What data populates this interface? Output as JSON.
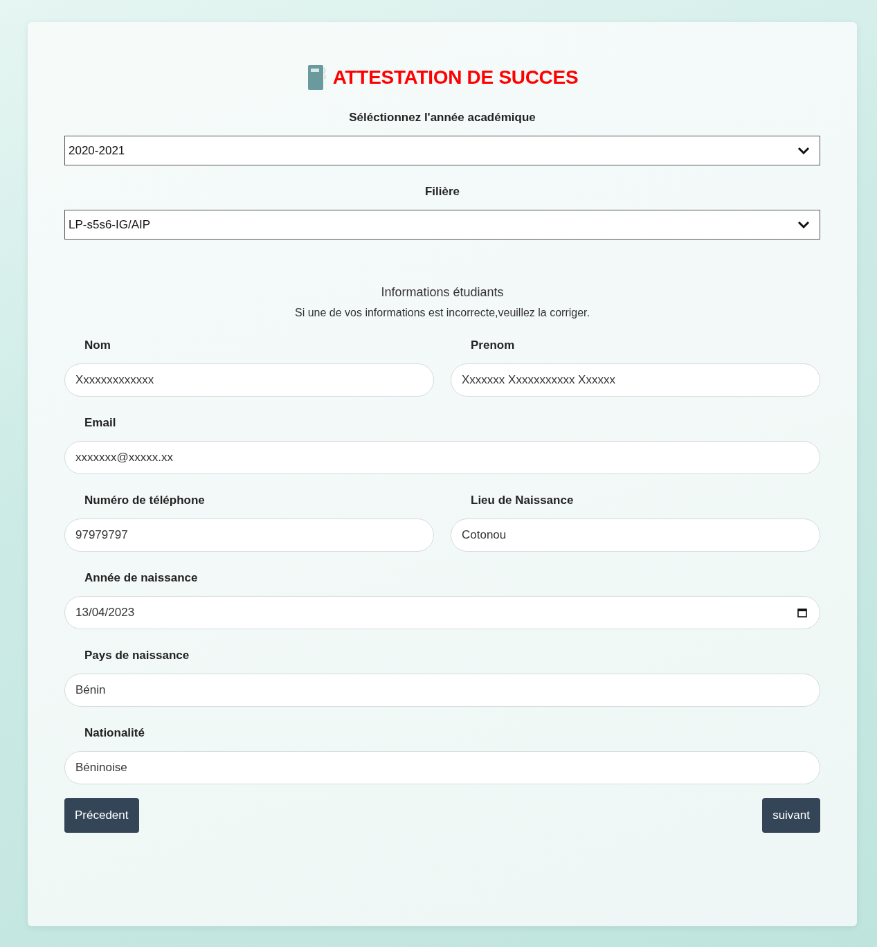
{
  "title": "ATTESTATION DE SUCCES",
  "selects": [
    {
      "label": "Séléctionnez l'année académique",
      "value": "2020-2021"
    },
    {
      "label": "Filière",
      "value": "LP-s5s6-IG/AIP"
    }
  ],
  "info": {
    "heading": "Informations étudiants",
    "note": "Si une de vos informations est incorrecte,veuillez la corriger."
  },
  "rows": [
    [
      {
        "label": "Nom",
        "value": "Xxxxxxxxxxxxx",
        "kind": "text"
      },
      {
        "label": "Prenom",
        "value": "Xxxxxxx Xxxxxxxxxxx Xxxxxx",
        "kind": "text"
      }
    ],
    [
      {
        "label": "Email",
        "value": "xxxxxxx@xxxxx.xx",
        "kind": "text"
      }
    ],
    [
      {
        "label": "Numéro de téléphone",
        "value": "97979797",
        "kind": "text"
      },
      {
        "label": "Lieu de Naissance",
        "value": "Cotonou",
        "kind": "text"
      }
    ],
    [
      {
        "label": "Année de naissance",
        "value": "13/04/2023",
        "kind": "date"
      }
    ],
    [
      {
        "label": "Pays de naissance",
        "value": "Bénin",
        "kind": "text"
      }
    ],
    [
      {
        "label": "Nationalité",
        "value": "Béninoise",
        "kind": "text"
      }
    ]
  ],
  "buttons": {
    "previous": "Précedent",
    "next": "suivant"
  }
}
